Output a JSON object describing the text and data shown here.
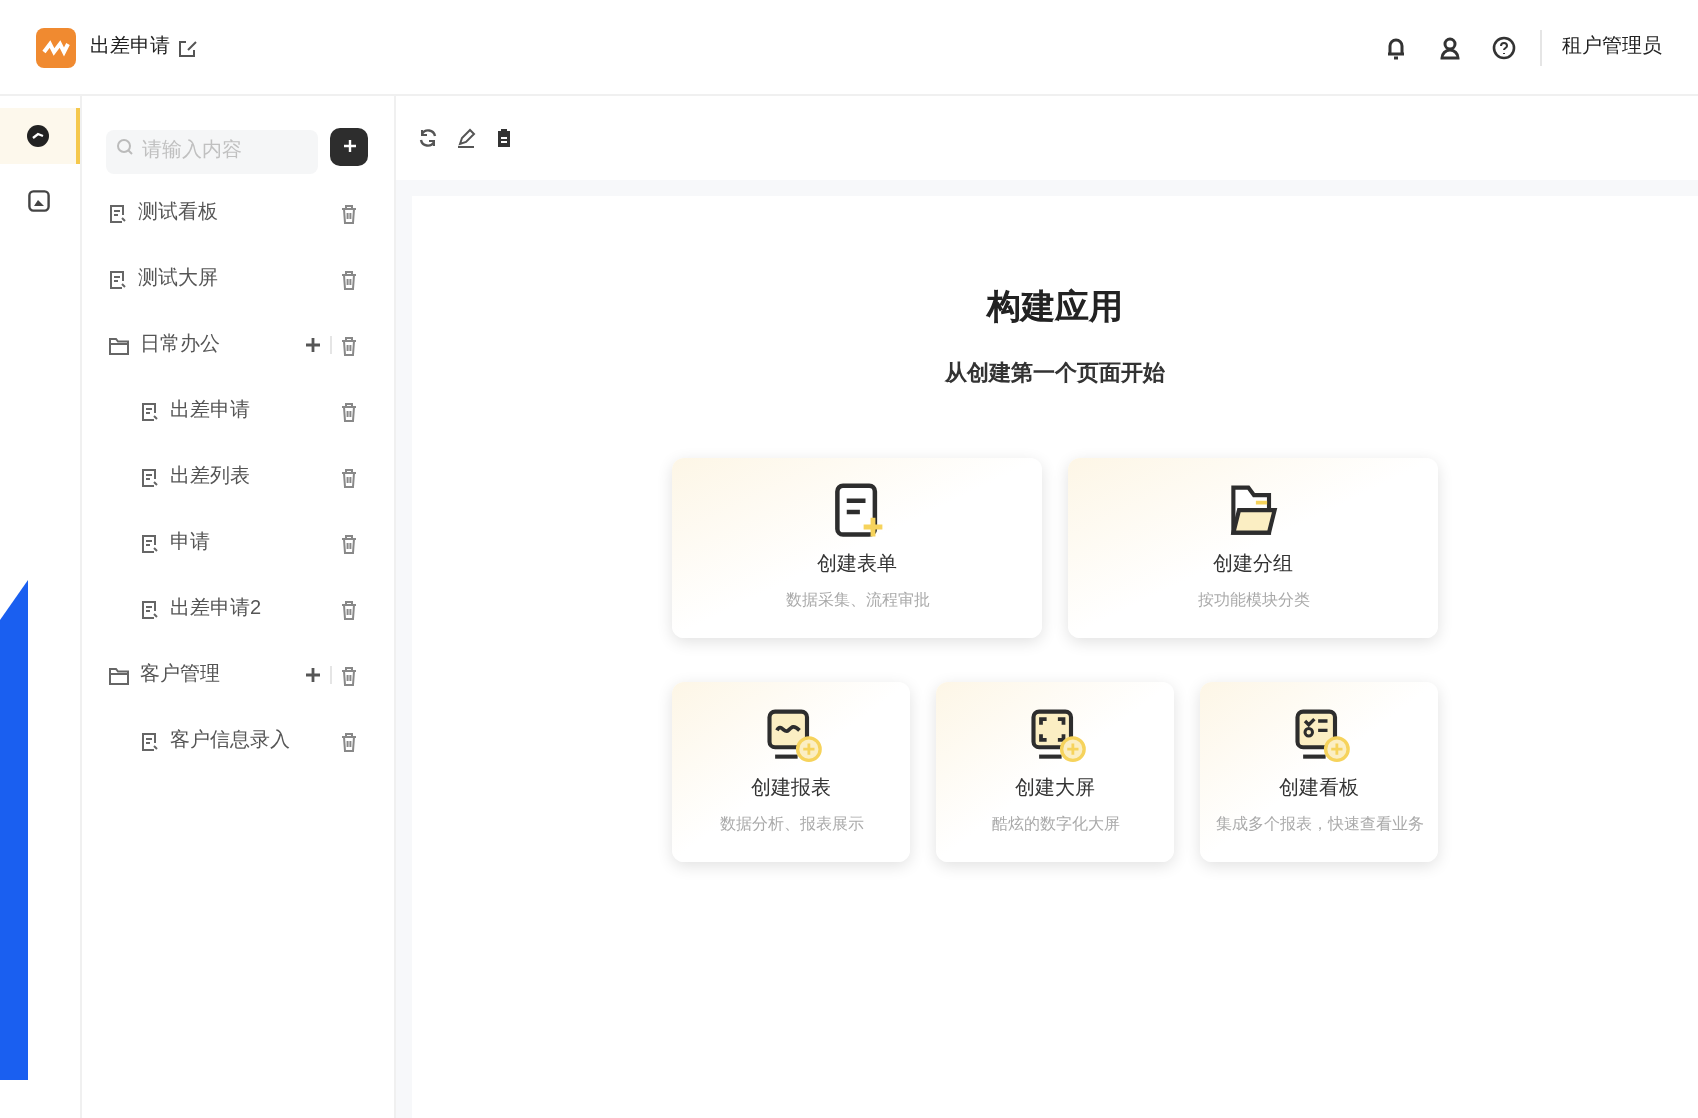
{
  "header": {
    "app_title": "出差申请",
    "user": "租户管理员"
  },
  "rail": [
    {
      "kind": "app",
      "selected": true
    },
    {
      "kind": "image",
      "selected": false
    }
  ],
  "sidebar": {
    "search": {
      "placeholder": "请输入内容"
    },
    "tree": [
      {
        "kind": "file",
        "label": "测试看板"
      },
      {
        "kind": "file",
        "label": "测试大屏"
      },
      {
        "kind": "folder",
        "label": "日常办公",
        "children": [
          {
            "kind": "file",
            "label": "出差申请"
          },
          {
            "kind": "file",
            "label": "出差列表"
          },
          {
            "kind": "file",
            "label": "申请"
          },
          {
            "kind": "file",
            "label": "出差申请2"
          }
        ]
      },
      {
        "kind": "folder",
        "label": "客户管理",
        "children": [
          {
            "kind": "file",
            "label": "客户信息录入"
          }
        ]
      }
    ]
  },
  "main": {
    "title": "构建应用",
    "subtitle": "从创建第一个页面开始",
    "cards": [
      [
        {
          "kind": "form",
          "title": "创建表单",
          "desc": "数据采集、流程审批"
        },
        {
          "kind": "group",
          "title": "创建分组",
          "desc": "按功能模块分类"
        }
      ],
      [
        {
          "kind": "report",
          "title": "创建报表",
          "desc": "数据分析、报表展示"
        },
        {
          "kind": "screen",
          "title": "创建大屏",
          "desc": "酷炫的数字化大屏"
        },
        {
          "kind": "board",
          "title": "创建看板",
          "desc": "集成多个报表，快速查看业务"
        }
      ]
    ]
  }
}
